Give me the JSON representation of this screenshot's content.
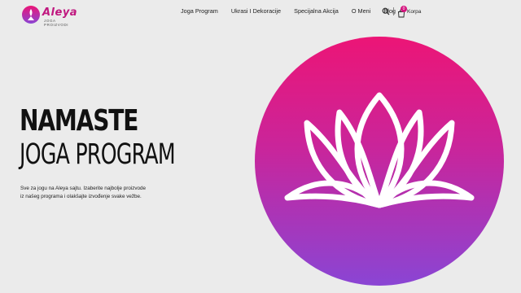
{
  "brand": {
    "name": "Aleya",
    "tagline": "JOGA PROIZVODI"
  },
  "nav": {
    "items": [
      {
        "label": "Joga Program"
      },
      {
        "label": "Ukrasi I Dekoracije"
      },
      {
        "label": "Specijalna Akcija"
      },
      {
        "label": "O Meni"
      },
      {
        "label": "Blog"
      }
    ],
    "cart_label": "Korpa",
    "cart_count": "0"
  },
  "hero": {
    "title_line1": "NAMASTE",
    "title_line2": "JOGA PROGRAM",
    "description_line1": "Sve za jogu na Aleya sajtu. Izaberite najbolje proizvode",
    "description_line2": "iz našeg programa i olakšajte izvođenje svake vežbe."
  },
  "colors": {
    "accent": "#d4157f",
    "gradient_top": "#ec1576",
    "gradient_bottom": "#8a45d4",
    "background": "#ebebeb"
  }
}
